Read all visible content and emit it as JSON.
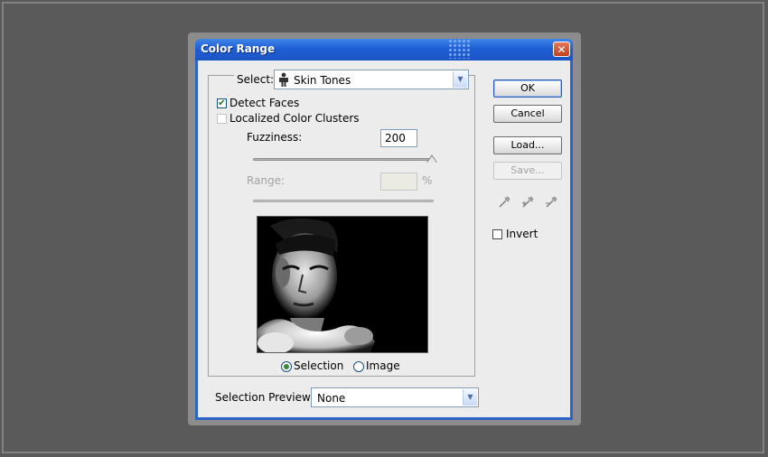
{
  "window": {
    "title": "Color Range",
    "close_glyph": "✕"
  },
  "select": {
    "label": "Select:",
    "value": "Skin Tones",
    "icon": "person-icon"
  },
  "options": {
    "detect_faces": {
      "label": "Detect Faces",
      "checked": true,
      "check_glyph": "✔"
    },
    "localized_color_clusters": {
      "label": "Localized Color Clusters",
      "checked": false
    }
  },
  "fuzziness": {
    "label": "Fuzziness:",
    "value": "200",
    "slider_fraction": 1.0
  },
  "range": {
    "label": "Range:",
    "value": "",
    "unit": "%"
  },
  "preview_mode": {
    "selection_label": "Selection",
    "image_label": "Image",
    "selected": "Selection"
  },
  "selection_preview": {
    "label": "Selection Preview:",
    "value": "None"
  },
  "buttons": {
    "ok": "OK",
    "cancel": "Cancel",
    "load": "Load...",
    "save": "Save..."
  },
  "eyedroppers": [
    "eyedropper-icon",
    "eyedropper-plus-icon",
    "eyedropper-minus-icon"
  ],
  "invert": {
    "label": "Invert",
    "checked": false
  },
  "colors": {
    "titlebar": "#1f5ed4",
    "dialog_bg": "#ececec",
    "backdrop": "#5a5a5a"
  }
}
